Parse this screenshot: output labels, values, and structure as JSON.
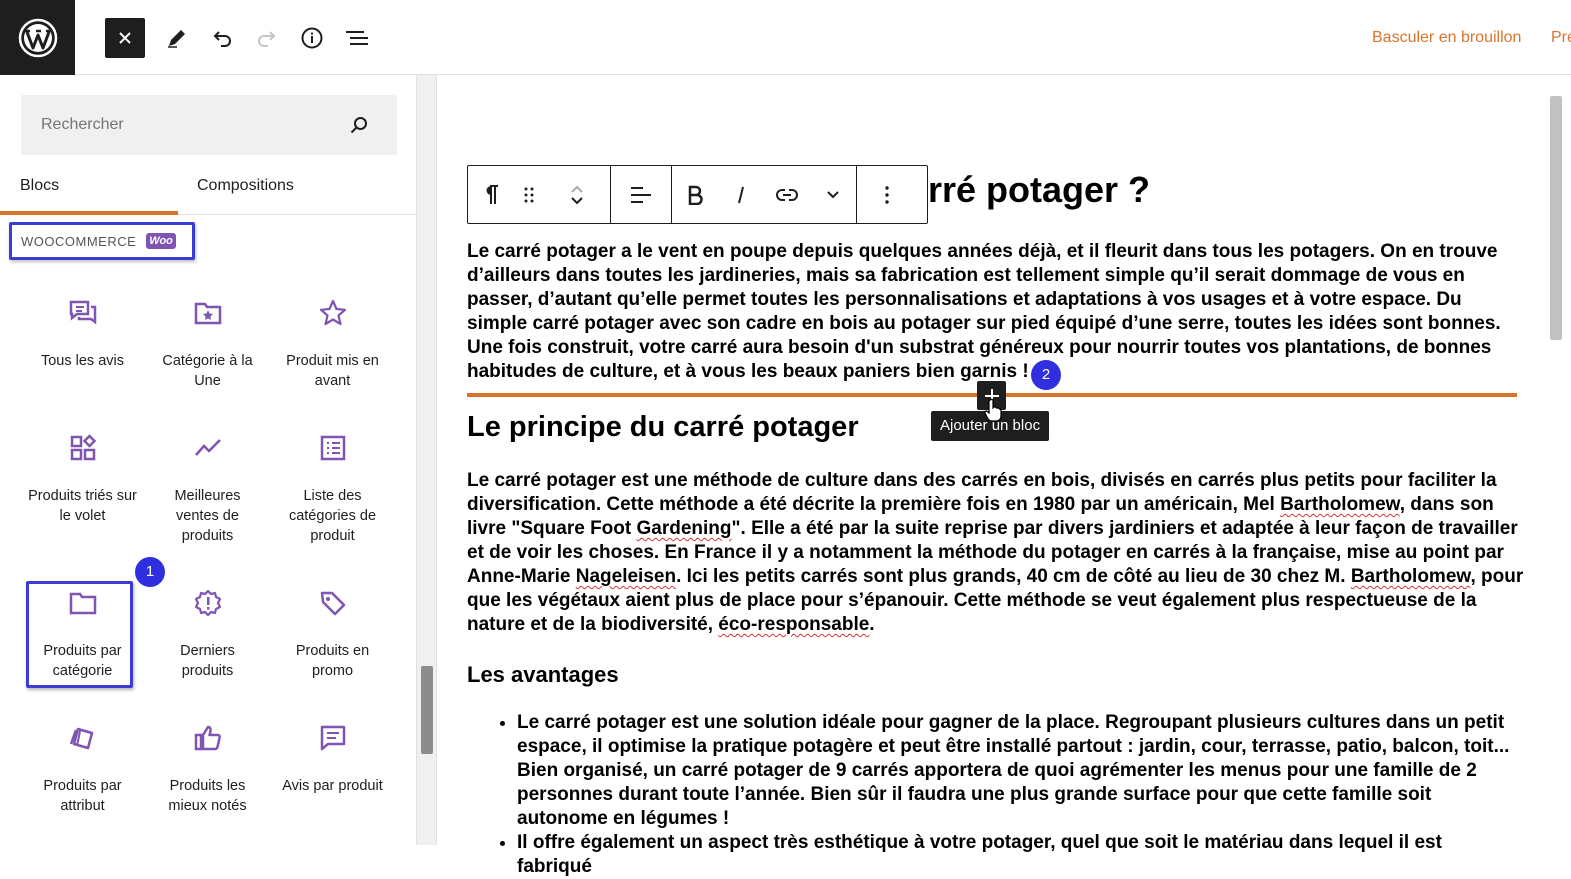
{
  "topbar": {
    "draft_link": "Basculer en brouillon",
    "preview_link": "Prévisualiser"
  },
  "inserter": {
    "search_placeholder": "Rechercher",
    "tabs": [
      {
        "label": "Blocs"
      },
      {
        "label": "Compositions"
      }
    ],
    "category": {
      "label": "WOOCOMMERCE",
      "badge": "Woo"
    },
    "blocks": [
      {
        "label": "Tous les avis",
        "icon": "reviews-icon"
      },
      {
        "label": "Catégorie à la Une",
        "icon": "featured-category-icon"
      },
      {
        "label": "Produit mis en avant",
        "icon": "star-icon"
      },
      {
        "label": "Produits triés sur le volet",
        "icon": "hand-picked-products-icon"
      },
      {
        "label": "Meilleures ventes de produits",
        "icon": "trending-icon"
      },
      {
        "label": "Liste des catégories de produit",
        "icon": "category-list-icon"
      },
      {
        "label": "Produits par catégorie",
        "icon": "folder-icon"
      },
      {
        "label": "Derniers produits",
        "icon": "new-products-icon"
      },
      {
        "label": "Produits en promo",
        "icon": "tag-icon"
      },
      {
        "label": "Produits par attribut",
        "icon": "attribute-icon"
      },
      {
        "label": "Produits les mieux notés",
        "icon": "thumbs-up-icon"
      },
      {
        "label": "Avis par produit",
        "icon": "product-reviews-icon"
      }
    ]
  },
  "badges": {
    "step1": "1",
    "step2": "2"
  },
  "editor": {
    "title_visible": "rré potager ?",
    "intro": "Le carré potager a le vent en poupe depuis quelques années déjà, et il fleurit dans tous les potagers. On en trouve d’ailleurs dans toutes les jardineries, mais sa fabrication est tellement simple qu’il serait dommage de vous en passer, d’autant qu’elle permet toutes les personnalisations et adaptations à vos usages et à votre espace. Du simple carré potager avec son cadre en bois au potager sur pied équipé d’une serre, toutes les idées sont bonnes. Une fois construit, votre carré aura besoin d'un substrat généreux pour nourrir toutes vos plantations, de bonnes habitudes de culture, et à vous les beaux paniers bien garnis !",
    "tooltip": "Ajouter un bloc",
    "heading_principe": "Le principe du carré potager",
    "principe": {
      "p1": "Le carré potager est une méthode de culture dans des carrés en bois, divisés en carrés plus petits pour faciliter la diversification. Cette méthode a été décrite la première fois en 1980 par un américain, Mel ",
      "name1": "Bartholomew",
      "p2": ", dans son livre \"Square Foot ",
      "word_gardening": "Gardening",
      "p3": "\". Elle a été par la suite reprise par divers jardiniers et adaptée à leur façon de travailler et de voir les choses. En France il y a notamment la méthode du potager en carrés à la française, mise au point par Anne-Marie ",
      "name2": "Nageleisen",
      "p4": ". Ici les petits carrés sont plus grands, 40 cm de côté au lieu de 30 chez M. ",
      "name3": "Bartholomew",
      "p5": ", pour que les végétaux aient plus de place pour s’épanouir. Cette méthode se veut également plus respectueuse de la nature et de la biodiversité, ",
      "word_eco": "éco-responsable",
      "p6": "."
    },
    "heading_avantages": "Les avantages",
    "list_items": [
      "Le carré potager est une solution idéale pour gagner de la place. Regroupant plusieurs cultures dans un petit espace, il optimise la pratique potagère et peut être installé partout : jardin, cour, terrasse, patio, balcon, toit... Bien organisé, un carré potager de 9 carrés apportera de quoi agrémenter les menus pour une famille de 2 personnes durant toute l’année. Bien sûr il faudra une plus grande surface pour que cette famille soit autonome en légumes !",
      "Il offre également un aspect très esthétique à votre potager, quel que soit le matériau dans lequel il est fabriqué"
    ]
  },
  "colors": {
    "accent": "#d9742b",
    "highlight": "#3c3cd4",
    "block_icon": "#7f54b3",
    "dark": "#1e1e1e"
  }
}
